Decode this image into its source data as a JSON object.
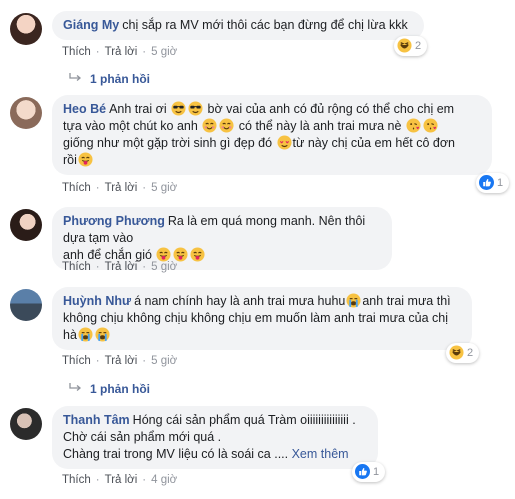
{
  "actions": {
    "like": "Thích",
    "reply": "Trả lời"
  },
  "comments": [
    {
      "author": "Giáng My",
      "text": "chị sắp ra MV mới thôi các bạn đừng để chị lừa kkk",
      "time": "5 giờ",
      "reaction_count": "2",
      "reaction_icon": "haha-icon",
      "replies_label": "1 phản hồi"
    },
    {
      "author": "Heo Bé",
      "text_parts": [
        "Anh trai ơi ",
        " bờ vai của anh có đủ rộng có thể cho chị em",
        "tựa vào một chút ko anh ",
        " có thể này là anh trai mưa nè ",
        "giống như một gặp trời sinh gì đẹp đó ",
        "từ này chị của em hết cô đơn",
        "rồi"
      ],
      "time": "5 giờ",
      "reaction_count": "1",
      "reaction_icon": "like-icon"
    },
    {
      "author": "Phương Phương",
      "text_parts": [
        "Ra là em quá mong manh. Nên thôi dựa tạm vào",
        "anh để chắn gió "
      ],
      "time": "5 giờ"
    },
    {
      "author": "Huỳnh Như",
      "text_parts": [
        "á nam chính hay là anh trai mưa huhu",
        "anh trai mưa thì",
        "không chịu không chịu không chịu em muốn làm anh trai mưa của chị",
        "hà"
      ],
      "time": "5 giờ",
      "reaction_count": "2",
      "reaction_icon": "haha-icon",
      "replies_label": "1 phản hồi"
    },
    {
      "author": "Thanh Tâm",
      "text_parts": [
        "Hóng cái sản phẩm quá Tràm oiiiiiiiiiiiiiii .",
        "Chờ cái sản phẩm mới quá .",
        "Chàng trai trong MV liệu có là soái ca .... "
      ],
      "see_more": "Xem thêm",
      "time": "4 giờ",
      "reaction_count": "1",
      "reaction_icon": "like-icon"
    }
  ],
  "colors": {
    "author": "#385898",
    "bubble": "#f2f3f5",
    "meta": "#90949c",
    "like_blue": "#1877f2",
    "emoji_yellow": "#f7c242"
  }
}
